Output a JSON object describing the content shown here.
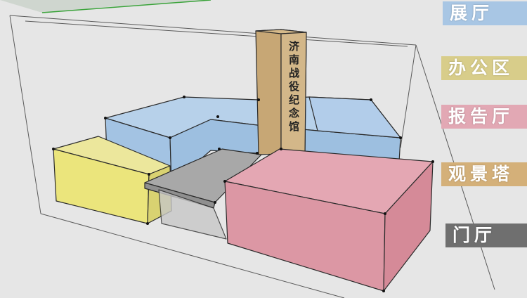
{
  "tower_inscription": "济南战役纪念馆",
  "legend": [
    {
      "label": "展厅",
      "color": "#a8c6e4"
    },
    {
      "label": "办公区",
      "color": "#d8cd8a"
    },
    {
      "label": "报告厅",
      "color": "#e2a8b4"
    },
    {
      "label": "观景塔",
      "color": "#d4b079"
    },
    {
      "label": "门厅",
      "color": "#6f6f6f"
    }
  ],
  "colors": {
    "background": "#e6e6e6",
    "exhibition_hall": "#a8c6e4",
    "office_area": "#e9e38a",
    "lecture_hall": "#d99aa6",
    "viewing_tower": "#c7a775",
    "entrance_hall": "#9a9a9a",
    "edges": "#2a2a2a"
  }
}
